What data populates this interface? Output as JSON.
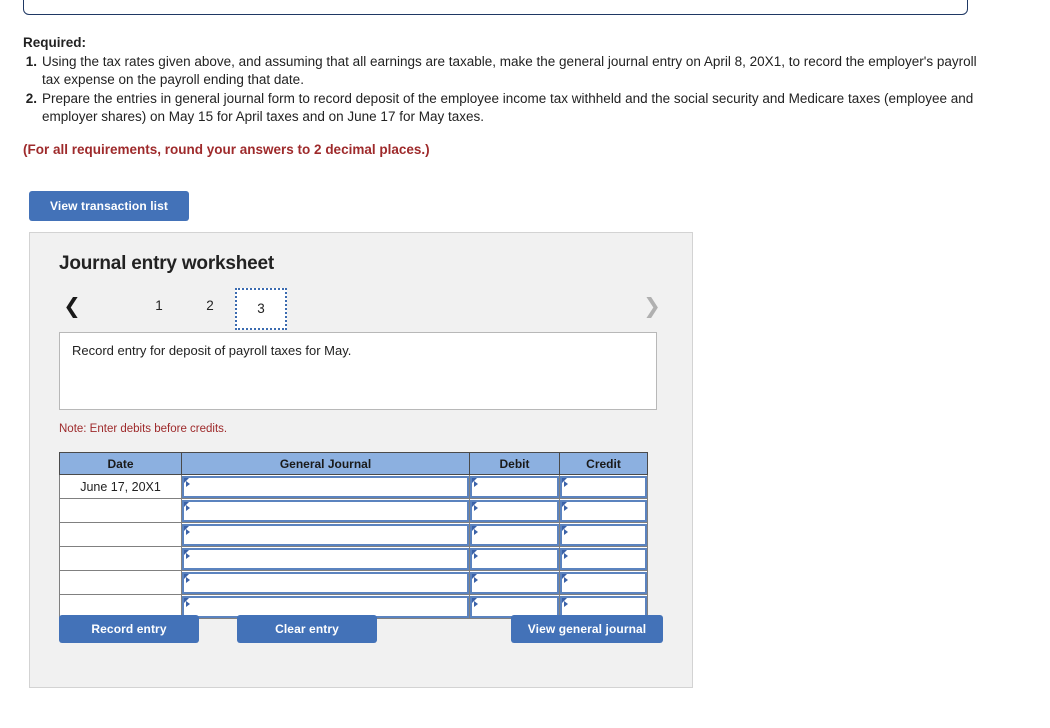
{
  "required": {
    "heading": "Required:",
    "items": [
      {
        "num": "1.",
        "text": "Using the tax rates given above, and assuming that all earnings are taxable, make the general journal entry on April 8, 20X1, to record the employer's payroll tax expense on the payroll ending that date."
      },
      {
        "num": "2.",
        "text": "Prepare the entries in general journal form to record deposit of the employee income tax withheld and the social security and Medicare taxes (employee and employer shares) on May 15 for April taxes and on June 17 for May taxes."
      }
    ],
    "rounding_note": "(For all requirements, round your answers to 2 decimal places.)"
  },
  "view_transaction_list_label": "View transaction list",
  "worksheet": {
    "title": "Journal entry worksheet",
    "tabs": [
      {
        "label": "1",
        "active": false
      },
      {
        "label": "2",
        "active": false
      },
      {
        "label": "3",
        "active": true
      }
    ],
    "prev_icon": "chevron-left",
    "next_icon": "chevron-right",
    "description": "Record entry for deposit of payroll taxes for May.",
    "note": "Note: Enter debits before credits.",
    "table": {
      "columns": [
        "Date",
        "General Journal",
        "Debit",
        "Credit"
      ],
      "rows": [
        {
          "date": "June 17, 20X1",
          "general_journal": "",
          "debit": "",
          "credit": ""
        },
        {
          "date": "",
          "general_journal": "",
          "debit": "",
          "credit": ""
        },
        {
          "date": "",
          "general_journal": "",
          "debit": "",
          "credit": ""
        },
        {
          "date": "",
          "general_journal": "",
          "debit": "",
          "credit": ""
        },
        {
          "date": "",
          "general_journal": "",
          "debit": "",
          "credit": ""
        },
        {
          "date": "",
          "general_journal": "",
          "debit": "",
          "credit": ""
        }
      ]
    },
    "buttons": {
      "record_entry": "Record entry",
      "clear_entry": "Clear entry",
      "view_general_journal": "View general journal"
    }
  },
  "colors": {
    "button_blue": "#4372b8",
    "header_blue": "#8cb0e0",
    "note_red": "#9e2a2b",
    "panel_gray": "#f1f1f1",
    "input_border": "#5b83bf"
  }
}
